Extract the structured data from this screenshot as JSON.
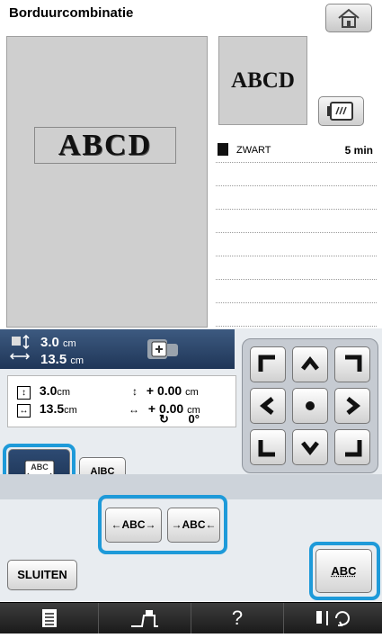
{
  "title": "Borduurcombinatie",
  "preview": {
    "pattern_text": "ABCD"
  },
  "thumbnail": {
    "pattern_text": "ABCD"
  },
  "thread_list": {
    "rows": [
      {
        "color_name": "ZWART",
        "time": "5 min"
      }
    ]
  },
  "size": {
    "height_value": "3.0",
    "height_unit": "cm",
    "width_value": "13.5",
    "width_unit": "cm"
  },
  "info": {
    "height_value": "3.0",
    "height_unit": "cm",
    "width_value": "13.5",
    "width_unit": "cm",
    "vert_offset": "+ 0.00",
    "vert_unit": "cm",
    "horiz_offset": "+ 0.00",
    "horiz_unit": "cm",
    "rotation": "0°"
  },
  "buttons": {
    "spacing_label": "A|BC",
    "arc_left_label": "←ABC→",
    "arc_right_label": "→ABC←",
    "close_label": "SLUITEN",
    "text_label": "ABC"
  },
  "bottom_bar": {
    "help_label": "?"
  },
  "colors": {
    "accent": "#1e9ad9",
    "panel_dark": "#1f3658"
  }
}
